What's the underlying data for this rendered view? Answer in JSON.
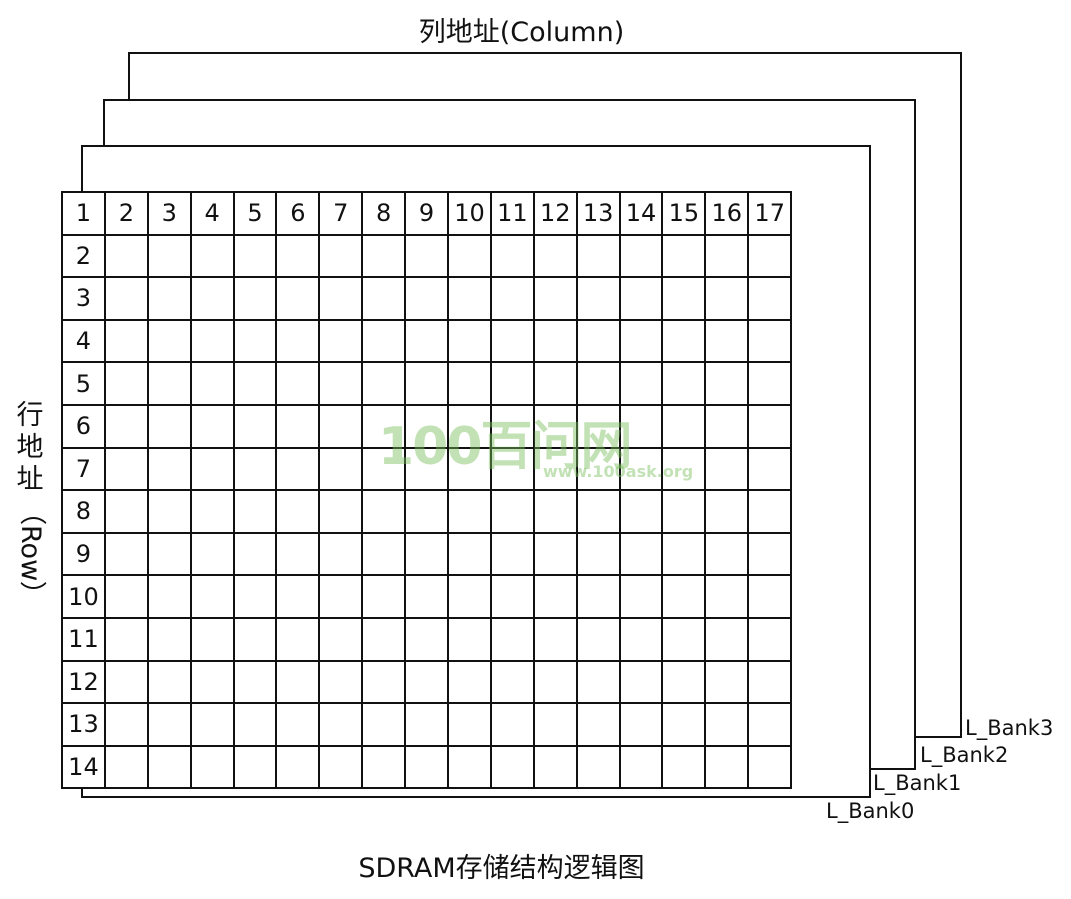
{
  "title_top": "列地址(Column)",
  "row_label_cjk": [
    "行",
    "地",
    "址"
  ],
  "row_label_latin": "（Row）",
  "banks": [
    "L_Bank0",
    "L_Bank1",
    "L_Bank2",
    "L_Bank3"
  ],
  "column_headers": [
    "1",
    "2",
    "3",
    "4",
    "5",
    "6",
    "7",
    "8",
    "9",
    "10",
    "11",
    "12",
    "13",
    "14",
    "15",
    "16",
    "17"
  ],
  "row_headers": [
    "2",
    "3",
    "4",
    "5",
    "6",
    "7",
    "8",
    "9",
    "10",
    "11",
    "12",
    "13",
    "14"
  ],
  "caption": "SDRAM存储结构逻辑图",
  "watermark": {
    "text": "100百问网",
    "url": "www.100ask.org"
  }
}
